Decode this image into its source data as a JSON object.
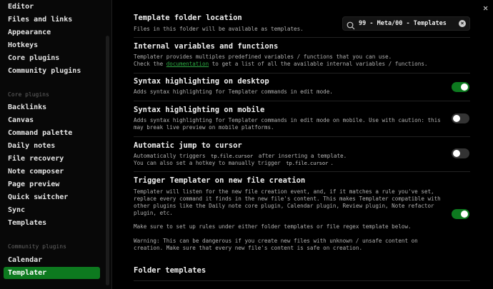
{
  "sidebar": {
    "top_items": [
      "Editor",
      "Files and links",
      "Appearance",
      "Hotkeys",
      "Core plugins",
      "Community plugins"
    ],
    "core_header": "Core plugins",
    "core_items": [
      "Backlinks",
      "Canvas",
      "Command palette",
      "Daily notes",
      "File recovery",
      "Note composer",
      "Page preview",
      "Quick switcher",
      "Sync",
      "Templates"
    ],
    "community_header": "Community plugins",
    "community_items": [
      "Calendar",
      "Templater"
    ],
    "active": "Templater"
  },
  "settings": {
    "folder": {
      "title": "Template folder location",
      "desc": "Files in this folder will be available as templates.",
      "value": "99 - Meta/00 - Templates"
    },
    "internal": {
      "title": "Internal variables and functions",
      "desc1": "Templater provides multiples predefined variables / functions that you can use.",
      "desc2a": "Check the ",
      "link": "documentation",
      "desc2b": " to get a list of all the available internal variables / functions."
    },
    "syntax_desktop": {
      "title": "Syntax highlighting on desktop",
      "desc": "Adds syntax highlighting for Templater commands in edit mode.",
      "enabled": true
    },
    "syntax_mobile": {
      "title": "Syntax highlighting on mobile",
      "desc": "Adds syntax highlighting for Templater commands in edit mode on mobile. Use with caution: this\nmay break live preview on mobile platforms.",
      "enabled": false
    },
    "jump": {
      "title": "Automatic jump to cursor",
      "desc1a": "Automatically triggers ",
      "code": "tp.file.cursor",
      "desc1b": " after inserting a template.",
      "desc2a": "You can also set a hotkey to manually trigger ",
      "desc2b": ".",
      "enabled": false
    },
    "trigger": {
      "title": "Trigger Templater on new file creation",
      "desc1": "Templater will listen for the new file creation event, and, if it matches a rule you've set,\nreplace every command it finds in the new file's content. This makes Templater compatible with\nother plugins like the Daily note core plugin, Calendar plugin, Review plugin, Note refactor\nplugin, etc.",
      "desc2": "Make sure to set up rules under either folder templates or file regex template below.",
      "desc3": "Warning: This can be dangerous if you create new files with unknown / unsafe content on\ncreation. Make sure that every new file's content is safe on creation.",
      "enabled": true
    },
    "folder_templates": {
      "title": "Folder templates"
    }
  },
  "close_label": "✕"
}
